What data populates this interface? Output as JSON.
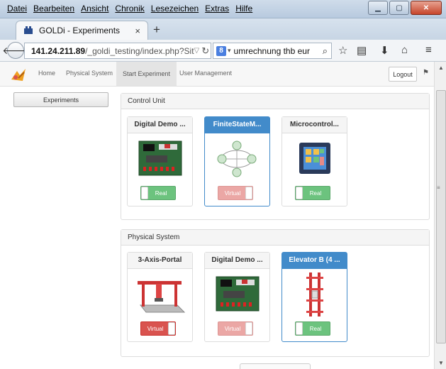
{
  "browser": {
    "menu": [
      "Datei",
      "Bearbeiten",
      "Ansicht",
      "Chronik",
      "Lesezeichen",
      "Extras",
      "Hilfe"
    ],
    "tab_title": "GOLDi - Experiments",
    "tab_close": "×",
    "new_tab": "+",
    "url_host": "141.24.211.89",
    "url_path": "/_goldi_testing/index.php?Sit",
    "search_engine": "8",
    "search_query": "umrechnung thb eur"
  },
  "site": {
    "nav": [
      "Home",
      "Physical System",
      "Start Experiment",
      "User Management"
    ],
    "active_nav": "Start Experiment",
    "logout": "Logout",
    "sidebar_button": "Experiments"
  },
  "control_unit": {
    "title": "Control Unit",
    "cards": [
      {
        "title": "Digital Demo ...",
        "toggle": "Real",
        "selected": false
      },
      {
        "title": "FiniteStateM...",
        "toggle": "Virtual",
        "selected": true
      },
      {
        "title": "Microcontrol...",
        "toggle": "Real",
        "selected": false
      }
    ]
  },
  "physical_system": {
    "title": "Physical System",
    "cards": [
      {
        "title": "3-Axis-Portal",
        "toggle": "Virtual",
        "selected": false
      },
      {
        "title": "Digital Demo ...",
        "toggle": "Virtual",
        "selected": false
      },
      {
        "title": "Elevator B (4 ...",
        "toggle": "Real",
        "selected": true
      }
    ]
  },
  "colors": {
    "primary": "#428bca",
    "real": "#6cc37e",
    "virtual": "#d9534f"
  }
}
